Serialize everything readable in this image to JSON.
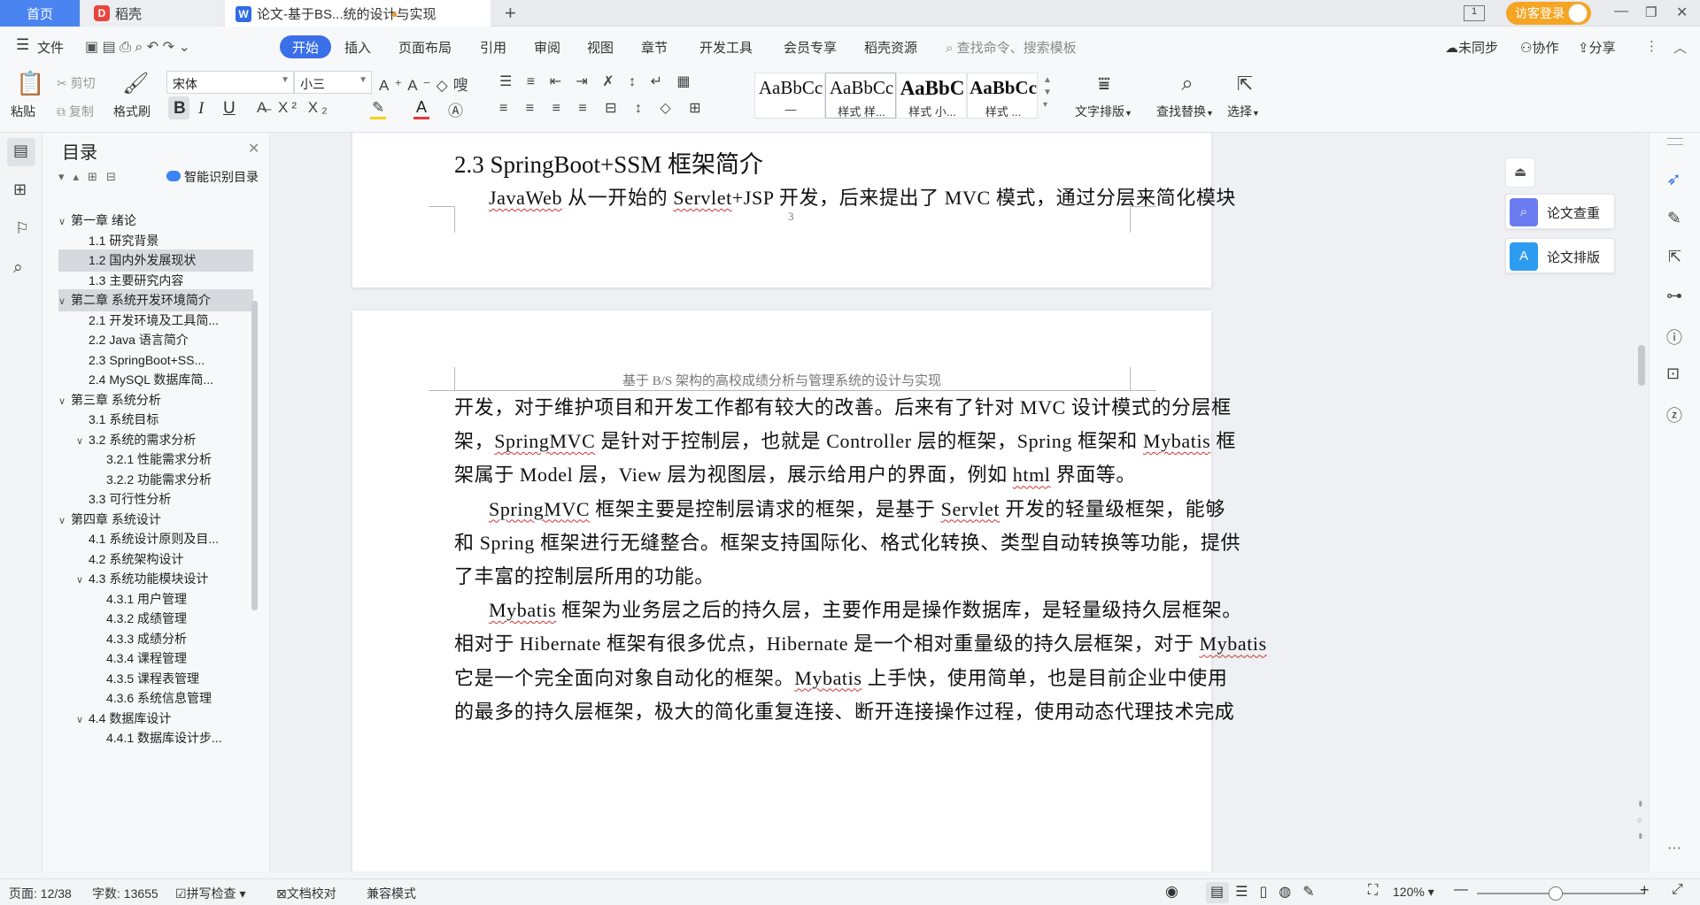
{
  "tabs": {
    "home": "首页",
    "daoke": "稻壳",
    "doc": "论文-基于BS...统的设计与实现",
    "login": "访客登录"
  },
  "menu": {
    "file": "文件",
    "items": [
      "开始",
      "插入",
      "页面布局",
      "引用",
      "审阅",
      "视图",
      "章节",
      "开发工具",
      "会员专享",
      "稻壳资源"
    ],
    "search_placeholder": "查找命令、搜索模板",
    "sync": "未同步",
    "collab": "协作",
    "share": "分享"
  },
  "ribbon": {
    "paste": "粘贴",
    "cut": "剪切",
    "copy": "复制",
    "format_painter": "格式刷",
    "font": "宋体",
    "size": "小三",
    "styles": [
      {
        "sample": "AaBbCc",
        "name": "—"
      },
      {
        "sample": "AaBbCc",
        "name": "样式 样..."
      },
      {
        "sample": "AaBbC",
        "name": "样式 小..."
      },
      {
        "sample": "AaBbCc",
        "name": "样式 ..."
      }
    ],
    "text_layout": "文字排版",
    "find_replace": "查找替换",
    "select": "选择"
  },
  "toc": {
    "title": "目录",
    "smart": "智能识别目录",
    "items": [
      {
        "label": "第一章  绪论",
        "level": 1,
        "caret": "open"
      },
      {
        "label": "1.1  研究背景",
        "level": 2
      },
      {
        "label": "1.2  国内外发展现状",
        "level": 2,
        "selected": true
      },
      {
        "label": "1.3  主要研究内容",
        "level": 2
      },
      {
        "label": "第二章  系统开发环境简介",
        "level": 1,
        "caret": "open",
        "selected": true
      },
      {
        "label": "2.1  开发环境及工具简...",
        "level": 2
      },
      {
        "label": "2.2 Java 语言简介",
        "level": 2
      },
      {
        "label": "2.3 SpringBoot+SS...",
        "level": 2
      },
      {
        "label": "2.4 MySQL 数据库简...",
        "level": 2
      },
      {
        "label": "第三章  系统分析",
        "level": 1,
        "caret": "open"
      },
      {
        "label": "3.1  系统目标",
        "level": 2
      },
      {
        "label": "3.2  系统的需求分析",
        "level": 2,
        "caret": "open"
      },
      {
        "label": "3.2.1  性能需求分析",
        "level": 3
      },
      {
        "label": "3.2.2  功能需求分析",
        "level": 3
      },
      {
        "label": "3.3  可行性分析",
        "level": 2
      },
      {
        "label": "第四章  系统设计",
        "level": 1,
        "caret": "open"
      },
      {
        "label": "4.1  系统设计原则及目...",
        "level": 2
      },
      {
        "label": "4.2  系统架构设计",
        "level": 2
      },
      {
        "label": "4.3  系统功能模块设计",
        "level": 2,
        "caret": "open"
      },
      {
        "label": "4.3.1  用户管理",
        "level": 3
      },
      {
        "label": "4.3.2  成绩管理",
        "level": 3
      },
      {
        "label": "4.3.3  成绩分析",
        "level": 3
      },
      {
        "label": "4.3.4  课程管理",
        "level": 3
      },
      {
        "label": "4.3.5  课程表管理",
        "level": 3
      },
      {
        "label": "4.3.6  系统信息管理",
        "level": 3
      },
      {
        "label": "4.4  数据库设计",
        "level": 2,
        "caret": "open"
      },
      {
        "label": "4.4.1  数据库设计步...",
        "level": 3
      }
    ]
  },
  "document": {
    "heading": "2.3 SpringBoot+SSM 框架简介",
    "page1_line": "JavaWeb 从一开始的 Servlet+JSP 开发，后来提出了 MVC 模式，通过分层来简化模块",
    "page_number": "3",
    "header": "基于 B/S 架构的高校成绩分析与管理系统的设计与实现",
    "lines": [
      "开发，对于维护项目和开发工作都有较大的改善。后来有了针对 MVC 设计模式的分层框",
      "架，SpringMVC 是针对于控制层，也就是 Controller 层的框架，Spring 框架和 Mybatis 框",
      "架属于 Model 层，View 层为视图层，展示给用户的界面，例如 html 界面等。",
      "SpringMVC 框架主要是控制层请求的框架，是基于 Servlet 开发的轻量级框架，能够",
      "和 Spring 框架进行无缝整合。框架支持国际化、格式化转换、类型自动转换等功能，提供",
      "了丰富的控制层所用的功能。",
      "Mybatis 框架为业务层之后的持久层，主要作用是操作数据库，是轻量级持久层框架。",
      "相对于 Hibernate 框架有很多优点，Hibernate 是一个相对重量级的持久层框架，对于 Mybatis",
      "它是一个完全面向对象自动化的框架。Mybatis 上手快，使用简单，也是目前企业中使用",
      "的最多的持久层框架，极大的简化重复连接、断开连接操作过程，使用动态代理技术完成"
    ]
  },
  "float": {
    "check": "论文查重",
    "layout": "论文排版"
  },
  "status": {
    "page": "页面: 12/38",
    "words": "字数: 13655",
    "spell": "拼写检查",
    "proof": "文档校对",
    "compat": "兼容模式",
    "zoom": "120%"
  }
}
